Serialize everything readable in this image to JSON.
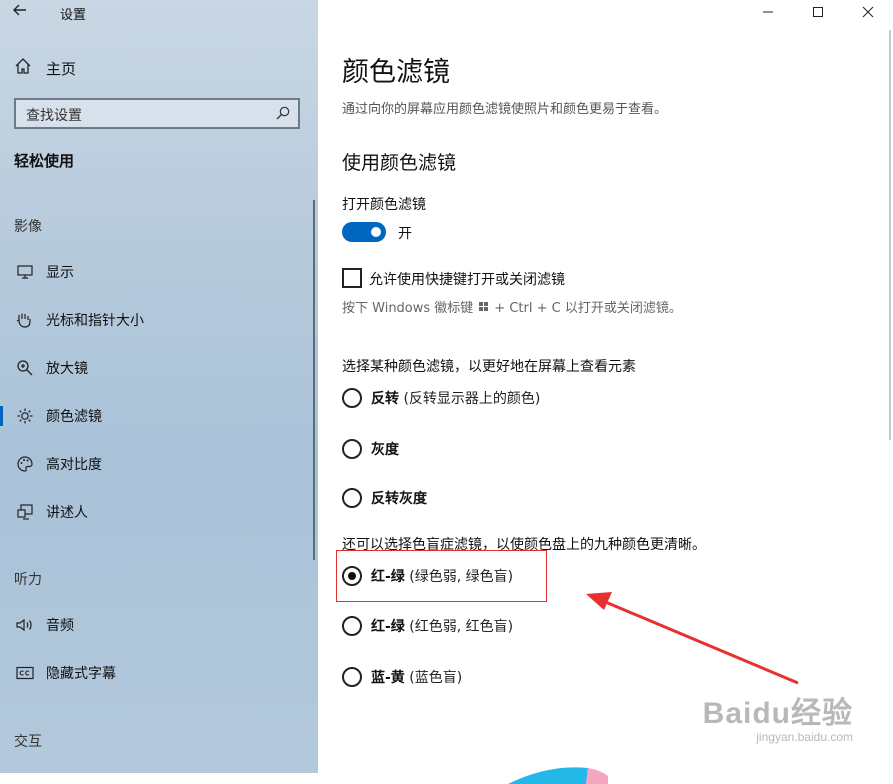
{
  "window": {
    "title": "设置",
    "controls": [
      "minimize-icon",
      "maximize-icon",
      "close-icon"
    ]
  },
  "sidebar": {
    "home_label": "主页",
    "search_placeholder": "查找设置",
    "section_title": "轻松使用",
    "groups": [
      {
        "title": "影像",
        "items": [
          {
            "label": "显示",
            "icon": "monitor-icon"
          },
          {
            "label": "光标和指针大小",
            "icon": "pointer-icon"
          },
          {
            "label": "放大镜",
            "icon": "magnifier-icon"
          },
          {
            "label": "颜色滤镜",
            "icon": "sun-icon",
            "active": true
          },
          {
            "label": "高对比度",
            "icon": "palette-icon"
          },
          {
            "label": "讲述人",
            "icon": "narrator-icon"
          }
        ]
      },
      {
        "title": "听力",
        "items": [
          {
            "label": "音频",
            "icon": "speaker-icon"
          },
          {
            "label": "隐藏式字幕",
            "icon": "captions-icon"
          }
        ]
      },
      {
        "title": "交互",
        "items": []
      }
    ]
  },
  "main": {
    "title": "颜色滤镜",
    "description": "通过向你的屏幕应用颜色滤镜使照片和颜色更易于查看。",
    "subtitle": "使用颜色滤镜",
    "toggle_label": "打开颜色滤镜",
    "toggle_state": "开",
    "toggle_on": true,
    "shortcut_checkbox_label": "允许使用快捷键打开或关闭滤镜",
    "shortcut_checked": false,
    "shortcut_hint_before": "按下 Windows 徽标键",
    "shortcut_hint_after": "+ Ctrl + C 以打开或关闭滤镜。",
    "filter_group_label": "选择某种颜色滤镜，以更好地在屏幕上查看元素",
    "filters": [
      {
        "name": "反转",
        "detail": " (反转显示器上的颜色)",
        "selected": false
      },
      {
        "name": "灰度",
        "detail": "",
        "selected": false
      },
      {
        "name": "反转灰度",
        "detail": "",
        "selected": false
      }
    ],
    "colorblind_group_label": "还可以选择色盲症滤镜，以使颜色盘上的九种颜色更清晰。",
    "colorblind_filters": [
      {
        "name": "红-绿",
        "detail": " (绿色弱, 绿色盲)",
        "selected": true
      },
      {
        "name": "红-绿",
        "detail": " (红色弱, 红色盲)",
        "selected": false
      },
      {
        "name": "蓝-黄",
        "detail": " (蓝色盲)",
        "selected": false
      }
    ]
  },
  "watermark": {
    "brand": "Baidu经验",
    "url": "jingyan.baidu.com"
  },
  "colors": {
    "accent": "#0067c0",
    "annotation": "#e03030"
  }
}
